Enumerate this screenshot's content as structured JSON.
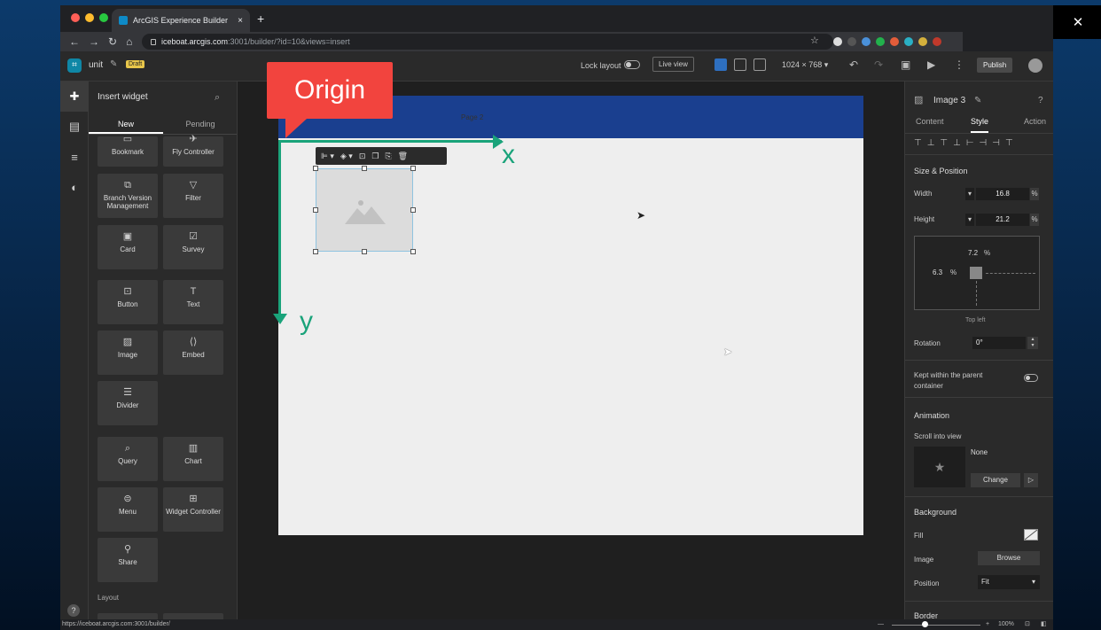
{
  "browser": {
    "tab_title": "ArcGIS Experience Builder",
    "tab_close": "×",
    "new_tab": "+",
    "url_host": "iceboat.arcgis.com",
    "url_rest": ":3001/builder/?id=10&views=insert",
    "status_url": "https://iceboat.arcgis.com:3001/builder/",
    "window_min": "—",
    "window_max": "☐",
    "window_close": "✕"
  },
  "header": {
    "app_name": "unit",
    "draft_badge": "Draft",
    "lock_layout": "Lock layout",
    "live_view": "Live view",
    "screen_size": "1024 × 768 ▾",
    "publish": "Publish"
  },
  "insert_panel": {
    "title": "Insert widget",
    "tabs": [
      "New",
      "Pending"
    ],
    "widgets": [
      {
        "label": "Bookmark",
        "icon": "bookmark-icon"
      },
      {
        "label": "Fly Controller",
        "icon": "fly-icon"
      },
      {
        "label": "Branch Version Management",
        "icon": "branch-icon"
      },
      {
        "label": "Filter",
        "icon": "filter-icon"
      },
      {
        "label": "Card",
        "icon": "card-icon"
      },
      {
        "label": "Survey",
        "icon": "survey-icon"
      },
      {
        "label": "Button",
        "icon": "button-icon"
      },
      {
        "label": "Text",
        "icon": "text-icon"
      },
      {
        "label": "Image",
        "icon": "image-icon"
      },
      {
        "label": "Embed",
        "icon": "embed-icon"
      },
      {
        "label": "Divider",
        "icon": "divider-icon"
      },
      {
        "label": "Query",
        "icon": "query-icon"
      },
      {
        "label": "Chart",
        "icon": "chart-icon"
      },
      {
        "label": "Menu",
        "icon": "menu-icon"
      },
      {
        "label": "Widget Controller",
        "icon": "widget-controller-icon"
      },
      {
        "label": "Share",
        "icon": "share-icon"
      }
    ],
    "layout_section": "Layout"
  },
  "canvas": {
    "page_title": "Page 2",
    "origin_label": "Origin",
    "x_label": "x",
    "y_label": "y"
  },
  "props": {
    "widget_name": "Image 3",
    "tabs": [
      "Content",
      "Style",
      "Action"
    ],
    "size_position": "Size & Position",
    "width_label": "Width",
    "width_value": "16.8",
    "height_label": "Height",
    "height_value": "21.2",
    "unit": "%",
    "top_value": "7.2",
    "left_value": "6.3",
    "anchor": "Top left",
    "rotation_label": "Rotation",
    "rotation_value": "0°",
    "keep_parent": "Kept within the parent container",
    "animation": "Animation",
    "scroll_into_view": "Scroll into view",
    "anim_none": "None",
    "change": "Change",
    "background": "Background",
    "fill": "Fill",
    "image": "Image",
    "browse": "Browse",
    "position": "Position",
    "position_value": "Fit",
    "border": "Border"
  },
  "footer": {
    "zoom": "100%"
  }
}
